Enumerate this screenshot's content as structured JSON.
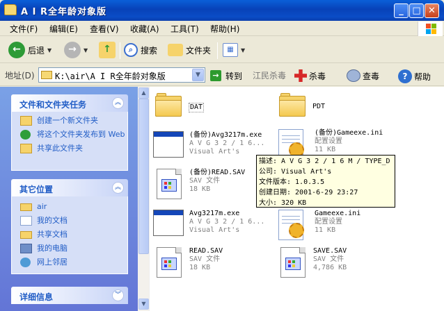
{
  "window": {
    "title": "A I R全年龄对象版",
    "controls": {
      "minimize": "_",
      "maximize": "□",
      "close": "✕"
    }
  },
  "menu": [
    "文件(F)",
    "编辑(E)",
    "查看(V)",
    "收藏(A)",
    "工具(T)",
    "帮助(H)"
  ],
  "toolbar": {
    "back": "后退",
    "search": "搜索",
    "folders": "文件夹"
  },
  "address": {
    "label": "地址(D)",
    "path": "K:\\air\\A I R全年龄对象版",
    "go": "转到",
    "av_label": "江民杀毒",
    "kill": "杀毒",
    "scan": "查毒",
    "help": "帮助"
  },
  "left_pane": {
    "tasks": {
      "title": "文件和文件夹任务",
      "items": [
        {
          "label": "创建一个新文件夹"
        },
        {
          "label": "将这个文件夹发布到 Web"
        },
        {
          "label": "共享此文件夹"
        }
      ]
    },
    "places": {
      "title": "其它位置",
      "items": [
        {
          "label": "air"
        },
        {
          "label": "我的文档"
        },
        {
          "label": "共享文档"
        },
        {
          "label": "我的电脑"
        },
        {
          "label": "网上邻居"
        }
      ]
    },
    "details": {
      "title": "详细信息"
    }
  },
  "files": [
    {
      "name": "DAT",
      "type": "folder"
    },
    {
      "name": "PDT",
      "type": "folder"
    },
    {
      "name": "(备份)Avg3217m.exe",
      "line2": "A V G 3 2 / 1 6...",
      "line3": "Visual Art's",
      "type": "exe"
    },
    {
      "name": "(备份)Gameexe.ini",
      "line2": "配置设置",
      "line3": "11 KB",
      "type": "ini"
    },
    {
      "name": "(备份)READ.SAV",
      "line2": "SAV 文件",
      "line3": "18 KB",
      "type": "sav"
    },
    {
      "name": "Avg3217m.exe",
      "line2": "A V G 3 2 / 1 6...",
      "line3": "Visual Art's",
      "type": "exe"
    },
    {
      "name": "Gameexe.ini",
      "line2": "配置设置",
      "line3": "11 KB",
      "type": "ini"
    },
    {
      "name": "READ.SAV",
      "line2": "SAV 文件",
      "line3": "18 KB",
      "type": "sav"
    },
    {
      "name": "SAVE.SAV",
      "line2": "SAV 文件",
      "line3": "4,786 KB",
      "type": "sav"
    }
  ],
  "tooltip": {
    "desc": "描述: A V G 3 2 / 1 6 M / TYPE_D",
    "company": "公司: Visual Art's",
    "version": "文件版本: 1.0.3.5",
    "created": "创建日期: 2001-6-29 23:27",
    "size": "大小: 320 KB"
  }
}
